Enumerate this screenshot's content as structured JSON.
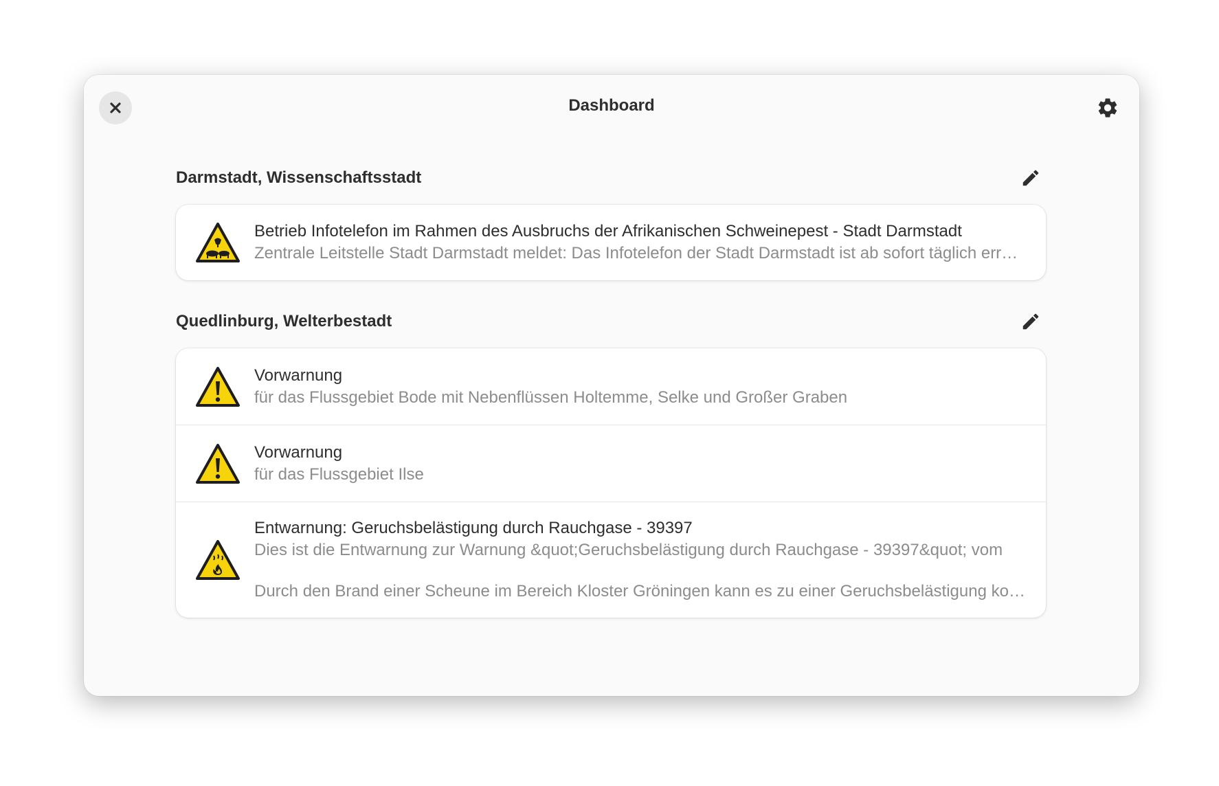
{
  "window": {
    "title": "Dashboard",
    "close_icon": "close-icon",
    "settings_icon": "gear-icon"
  },
  "sections": [
    {
      "title": "Darmstadt, Wissenschaftsstadt",
      "edit_icon": "pencil-icon",
      "items": [
        {
          "icon": "animal-disease-warning-icon",
          "title": "Betrieb Infotelefon im Rahmen des Ausbruchs der Afrikanischen Schweinepest - Stadt Darmstadt",
          "subtitle": "Zentrale Leitstelle Stadt Darmstadt meldet: Das Infotelefon der Stadt Darmstadt ist ab sofort täglich erreichbar"
        }
      ]
    },
    {
      "title": "Quedlinburg, Welterbestadt",
      "edit_icon": "pencil-icon",
      "items": [
        {
          "icon": "exclamation-warning-icon",
          "title": "Vorwarnung",
          "subtitle": "für das Flussgebiet Bode mit Nebenflüssen Holtemme, Selke und Großer Graben"
        },
        {
          "icon": "exclamation-warning-icon",
          "title": "Vorwarnung",
          "subtitle": "für das Flussgebiet Ilse"
        },
        {
          "icon": "fire-smoke-warning-icon",
          "title": "Entwarnung: Geruchsbelästigung durch Rauchgase - 39397",
          "subtitle": "Dies ist die Entwarnung zur Warnung &quot;Geruchsbelästigung durch Rauchgase - 39397&quot; vom",
          "subtitle2": "Durch den Brand einer Scheune im Bereich Kloster Gröningen kann es zu einer Geruchsbelästigung kommen"
        }
      ]
    }
  ],
  "colors": {
    "warning_yellow": "#f6d30b",
    "accent_dark": "#1e1e1e"
  }
}
